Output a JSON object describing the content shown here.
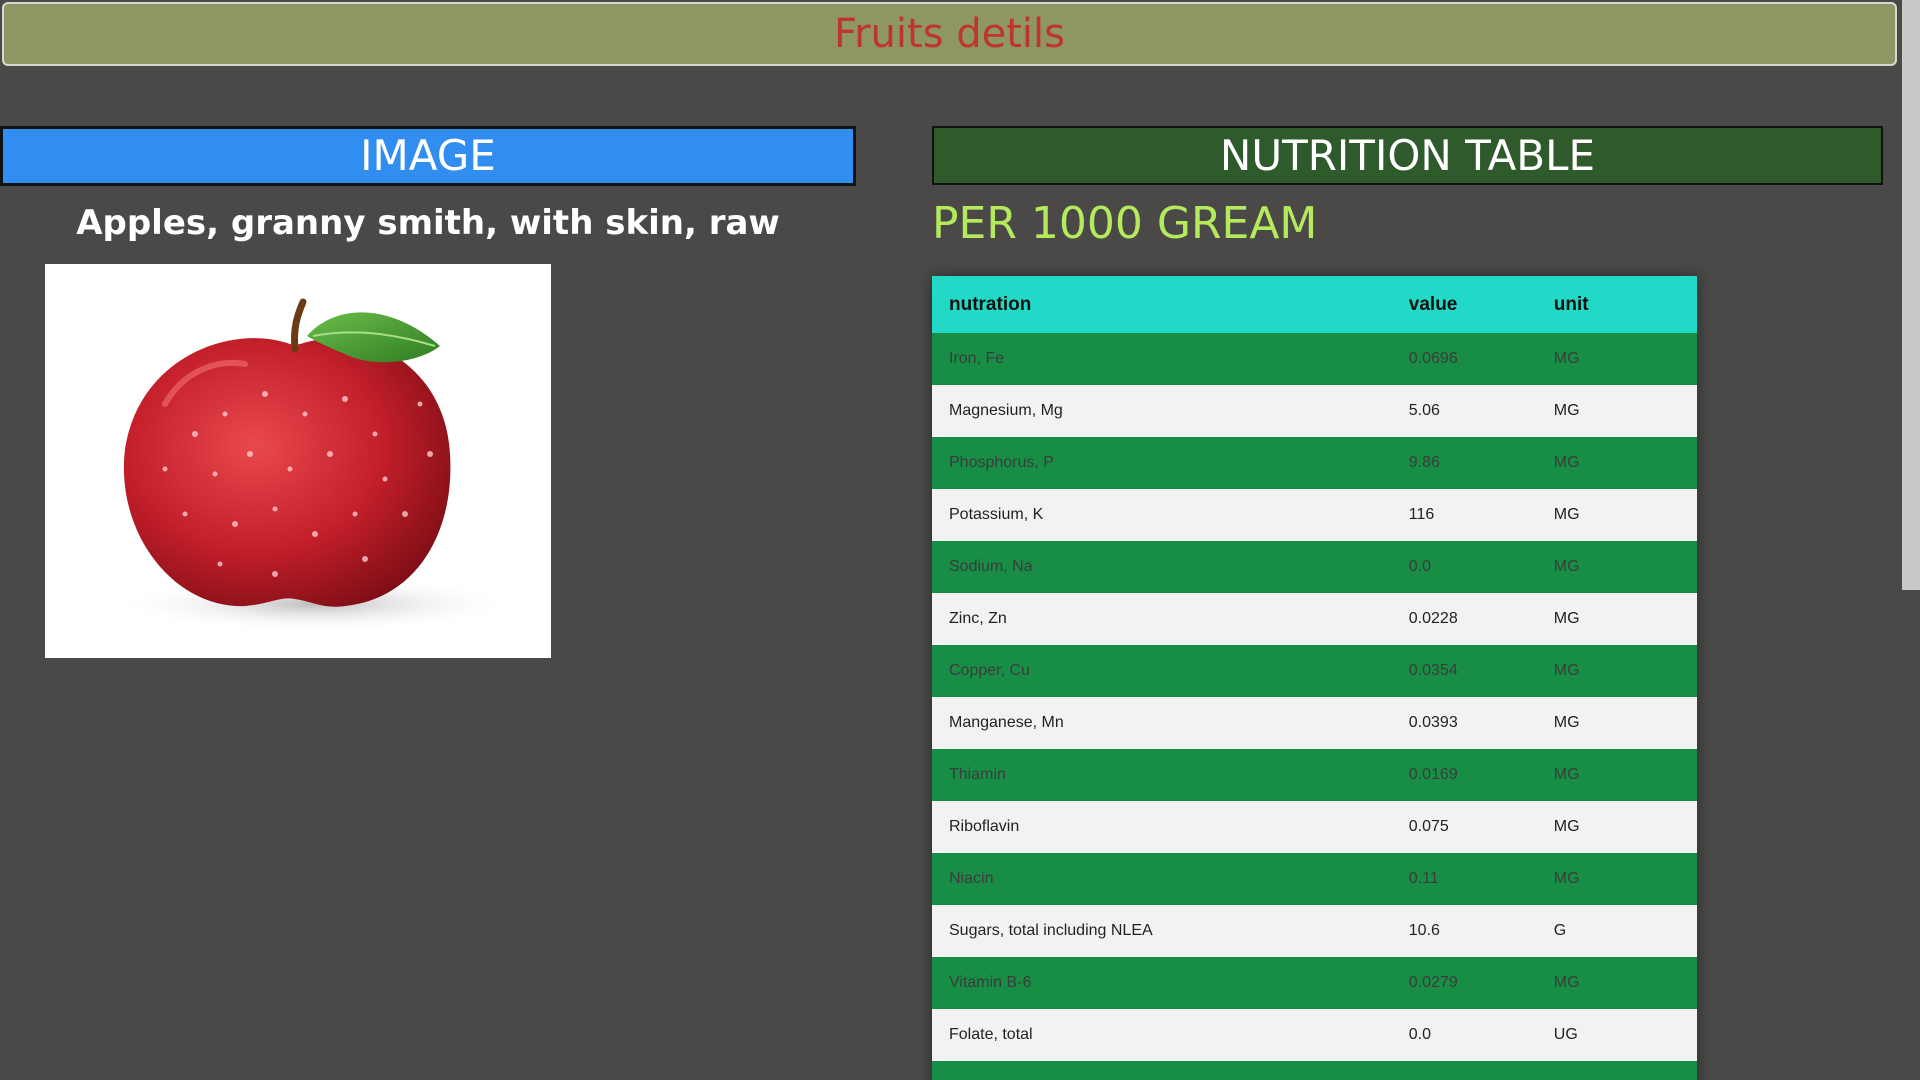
{
  "page_title": "Fruits detils",
  "image_section": {
    "header": "IMAGE",
    "fruit_name": "Apples, granny smith, with skin, raw",
    "photo_icon": "apple-photo"
  },
  "nutrition_section": {
    "header": "NUTRITION TABLE",
    "per_label": "PER 1000 GREAM",
    "columns": [
      "nutration",
      "value",
      "unit"
    ],
    "rows": [
      {
        "name": "Iron, Fe",
        "value": "0.0696",
        "unit": "MG"
      },
      {
        "name": "Magnesium, Mg",
        "value": "5.06",
        "unit": "MG"
      },
      {
        "name": "Phosphorus, P",
        "value": "9.86",
        "unit": "MG"
      },
      {
        "name": "Potassium, K",
        "value": "116",
        "unit": "MG"
      },
      {
        "name": "Sodium, Na",
        "value": "0.0",
        "unit": "MG"
      },
      {
        "name": "Zinc, Zn",
        "value": "0.0228",
        "unit": "MG"
      },
      {
        "name": "Copper, Cu",
        "value": "0.0354",
        "unit": "MG"
      },
      {
        "name": "Manganese, Mn",
        "value": "0.0393",
        "unit": "MG"
      },
      {
        "name": "Thiamin",
        "value": "0.0169",
        "unit": "MG"
      },
      {
        "name": "Riboflavin",
        "value": "0.075",
        "unit": "MG"
      },
      {
        "name": "Niacin",
        "value": "0.11",
        "unit": "MG"
      },
      {
        "name": "Sugars, total including NLEA",
        "value": "10.6",
        "unit": "G"
      },
      {
        "name": "Vitamin B-6",
        "value": "0.0279",
        "unit": "MG"
      },
      {
        "name": "Folate, total",
        "value": "0.0",
        "unit": "UG"
      },
      {
        "name": "",
        "value": "",
        "unit": ""
      }
    ]
  },
  "colors": {
    "title_bar": "#8e9663",
    "title_text": "#c0352b",
    "image_header": "#318ef0",
    "nutrition_header": "#2f5a2c",
    "per_label": "#b4ea5c",
    "table_header": "#22d9c8",
    "row_odd": "#178d45",
    "row_even": "#f2f2f2",
    "background": "#4a4948"
  }
}
